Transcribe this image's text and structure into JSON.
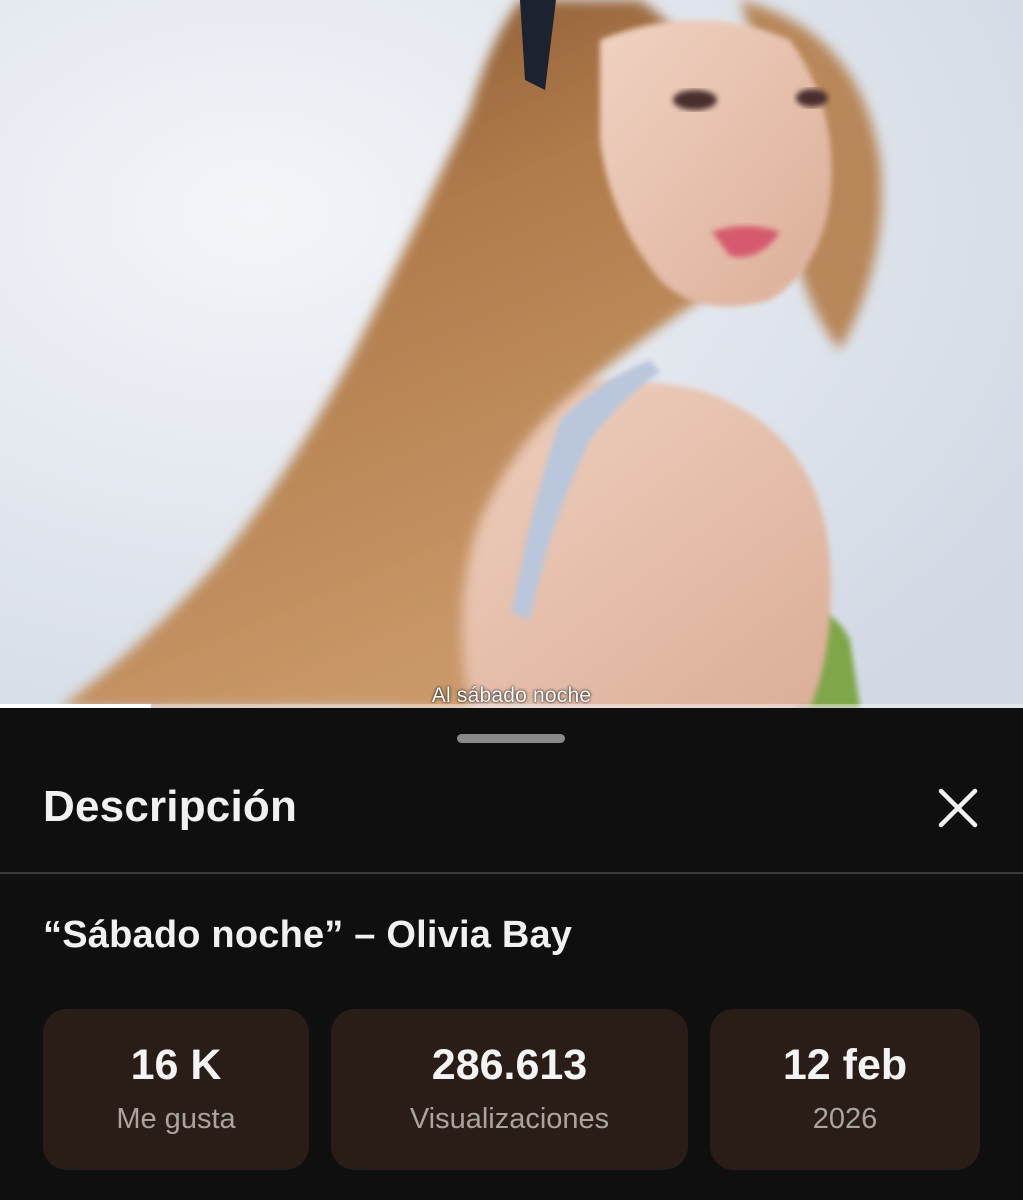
{
  "video": {
    "caption": "Al sábado noche",
    "progress_fraction": 0.148
  },
  "description_panel": {
    "title": "Descripción",
    "close_icon": "close-icon",
    "video_title": "“Sábado noche” – Olivia Bay",
    "stats": {
      "likes": {
        "value": "16 K",
        "label": "Me gusta"
      },
      "views": {
        "value": "286.613",
        "label": "Visualizaciones"
      },
      "date": {
        "value": "12 feb",
        "label": "2026"
      }
    }
  },
  "colors": {
    "background": "#0f0f0f",
    "stat_card": "#2a1d17",
    "text_primary": "#f1f1f1",
    "text_secondary": "#a9a4a1"
  }
}
